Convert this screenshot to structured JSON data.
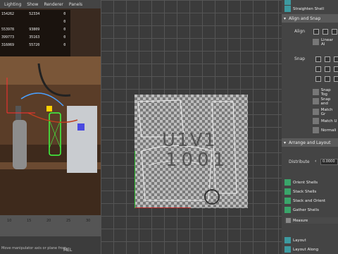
{
  "viewport": {
    "menu": [
      "Lighting",
      "Show",
      "Renderer",
      "Panels"
    ],
    "stats": [
      [
        "154262",
        "52334",
        "0"
      ],
      [
        "",
        "",
        "0"
      ],
      [
        "553978",
        "93809",
        "0"
      ],
      [
        "399773",
        "35163",
        "0"
      ],
      [
        "316069",
        "55720",
        "0"
      ]
    ],
    "timeline_ticks": [
      "10",
      "15",
      "20",
      "25",
      "30"
    ],
    "help_text": "Move manipulator axis or plane from",
    "mel_label": "MEL"
  },
  "uv_editor": {
    "tile_label_line1": "U1V1",
    "tile_label_line2": "1001"
  },
  "panel": {
    "top_items": [
      "Straighten Shell"
    ],
    "align_snap_section": "Align and Snap",
    "align_label": "Align",
    "linear_align": "Linear Al",
    "snap_label": "Snap",
    "snap_buttons": [
      "Snap Tog",
      "Snap and",
      "Match Gr",
      "Match U",
      "Normali"
    ],
    "arrange_section": "Arrange and Layout",
    "distribute_label": "Distribute",
    "distribute_value": "0.0000",
    "shell_buttons": [
      "Orient Shells",
      "Stack Shells",
      "Stack and Orient",
      "Gather Shells"
    ],
    "measure_label": "Measure",
    "layout_buttons": [
      "Layout",
      "Layout Along"
    ]
  }
}
